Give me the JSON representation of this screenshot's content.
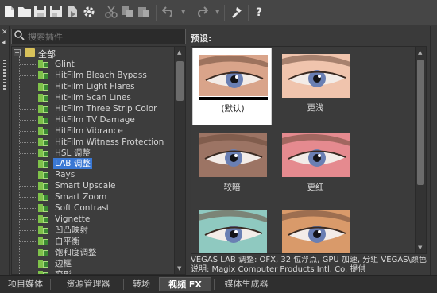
{
  "toolbar": {
    "icons": [
      "new-icon",
      "open-icon",
      "save-icon",
      "save-as-icon",
      "render-icon",
      "properties-icon",
      "cut-icon",
      "copy-icon",
      "paste-icon",
      "undo-icon",
      "redo-icon",
      "tool-icon",
      "help-icon"
    ],
    "help_label": "?"
  },
  "search": {
    "placeholder": "搜索插件"
  },
  "tree": {
    "root_label": "全部",
    "items": [
      {
        "label": "Glint"
      },
      {
        "label": "HitFilm Bleach Bypass"
      },
      {
        "label": "HitFilm Light Flares"
      },
      {
        "label": "HitFilm Scan Lines"
      },
      {
        "label": "HitFilm Three Strip Color"
      },
      {
        "label": "HitFilm TV Damage"
      },
      {
        "label": "HitFilm Vibrance"
      },
      {
        "label": "HitFilm Witness Protection"
      },
      {
        "label": "HSL 调整"
      },
      {
        "label": "LAB 调整",
        "selected": true
      },
      {
        "label": "Rays"
      },
      {
        "label": "Smart Upscale"
      },
      {
        "label": "Smart Zoom"
      },
      {
        "label": "Soft Contrast"
      },
      {
        "label": "Vignette"
      },
      {
        "label": "凹凸映射"
      },
      {
        "label": "白平衡"
      },
      {
        "label": "饱和度调整"
      },
      {
        "label": "边框"
      },
      {
        "label": "变形"
      }
    ]
  },
  "presets": {
    "heading": "预设:",
    "items": [
      {
        "label": "(默认)",
        "tint": "#d9a48a",
        "selected": true
      },
      {
        "label": "更浅",
        "tint": "#f0c4ad"
      },
      {
        "label": "较暗",
        "tint": "#9c7464"
      },
      {
        "label": "更红",
        "tint": "#e58a8f"
      },
      {
        "label": "",
        "tint": "#8fc9c0"
      },
      {
        "label": "",
        "tint": "#d99a6a"
      }
    ]
  },
  "description": {
    "line1": "VEGAS LAB 调整: OFX, 32 位浮点, GPU 加速, 分组 VEGAS\\颜色",
    "line2": "说明: Magix Computer Products Intl. Co. 提供"
  },
  "tabs": [
    {
      "label": "项目媒体"
    },
    {
      "label": "资源管理器"
    },
    {
      "label": "转场"
    },
    {
      "label": "视频 FX",
      "active": true
    },
    {
      "label": "媒体生成器"
    }
  ],
  "colors": {
    "selection": "#3a78d4",
    "fx_green": "#7fc24a",
    "panel_bg": "#3b3b3b"
  }
}
